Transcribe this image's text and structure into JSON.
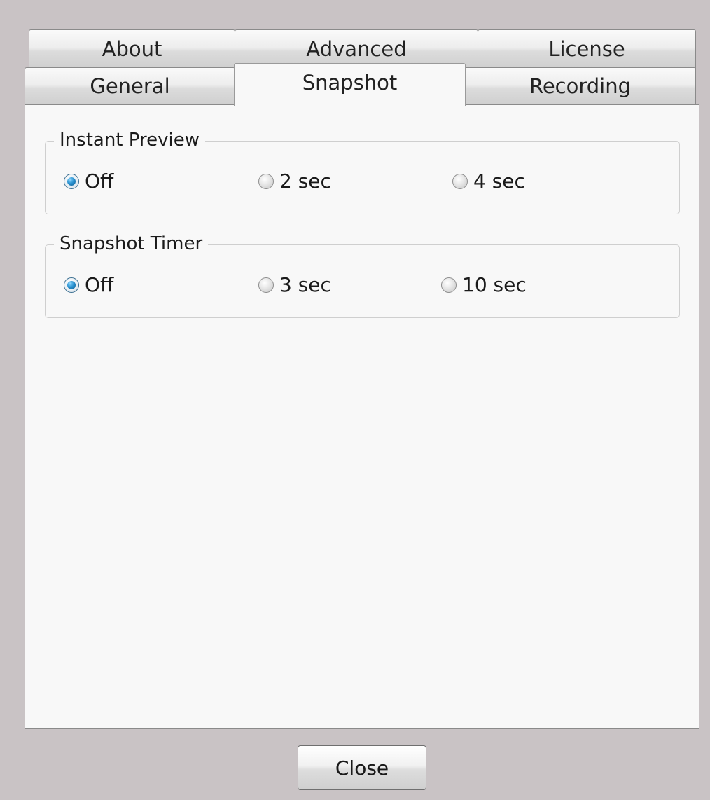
{
  "tabs": {
    "row_top": [
      {
        "label": "About",
        "active": false
      },
      {
        "label": "Advanced",
        "active": false
      },
      {
        "label": "License",
        "active": false
      }
    ],
    "row_bottom": [
      {
        "label": "General",
        "active": false
      },
      {
        "label": "Snapshot",
        "active": true
      },
      {
        "label": "Recording",
        "active": false
      }
    ]
  },
  "instant_preview": {
    "title": "Instant Preview",
    "options": [
      {
        "label": "Off",
        "checked": true
      },
      {
        "label": "2 sec",
        "checked": false
      },
      {
        "label": "4 sec",
        "checked": false
      }
    ]
  },
  "snapshot_timer": {
    "title": "Snapshot Timer",
    "options": [
      {
        "label": "Off",
        "checked": true
      },
      {
        "label": "3 sec",
        "checked": false
      },
      {
        "label": "10 sec",
        "checked": false
      }
    ]
  },
  "close_button": {
    "label": "Close"
  },
  "colors": {
    "dialog_background": "#c9c3c5",
    "panel_background": "#f8f8f8",
    "radio_selected_accent": "#2a92d0"
  }
}
